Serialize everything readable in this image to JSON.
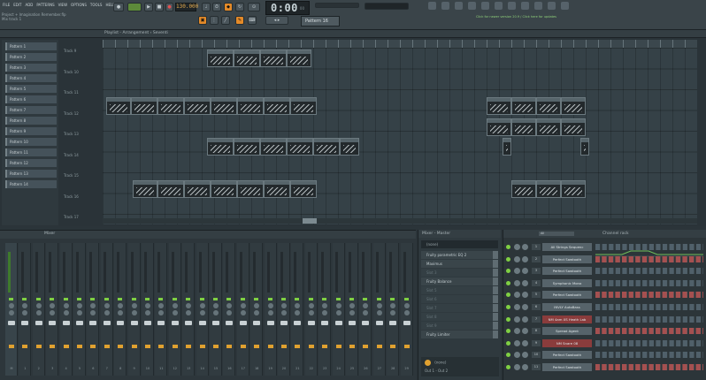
{
  "menu": [
    "FILE",
    "EDIT",
    "ADD",
    "PATTERNS",
    "VIEW",
    "OPTIONS",
    "TOOLS",
    "HELP"
  ],
  "project": {
    "name": "Project + Imagination Remember.flp",
    "subtitle": "Mix track 1"
  },
  "transport": {
    "tempo": "130.000",
    "time": "0:00",
    "time_sub": "00",
    "pattern": "Pattern 16"
  },
  "hint": "Click for newer version 20.9 / Click here for updates",
  "playlist": {
    "title": "Playlist - Arrangement › Seventi",
    "patterns": [
      "Pattern 1",
      "Pattern 2",
      "Pattern 3",
      "Pattern 4",
      "Pattern 5",
      "Pattern 6",
      "Pattern 7",
      "Pattern 8",
      "Pattern 9",
      "Pattern 10",
      "Pattern 11",
      "Pattern 12",
      "Pattern 13",
      "Pattern 14"
    ],
    "tracks": [
      "Track 9",
      "Track 10",
      "Track 11",
      "Track 12",
      "Track 13",
      "Track 14",
      "Track 15",
      "Track 16",
      "Track 17"
    ]
  },
  "mixer": {
    "title": "Mixer",
    "strips": [
      "M",
      "1",
      "2",
      "3",
      "4",
      "5",
      "6",
      "7",
      "8",
      "9",
      "10",
      "11",
      "12",
      "13",
      "14",
      "15",
      "16",
      "17",
      "18",
      "19",
      "20",
      "21",
      "22",
      "23",
      "24",
      "25",
      "26",
      "27",
      "28",
      "29"
    ]
  },
  "inserts": {
    "title": "Mixer - Master",
    "input": "(none)",
    "slots": [
      {
        "name": "Fruity parametric EQ 2",
        "empty": false
      },
      {
        "name": "Maximus",
        "empty": false
      },
      {
        "name": "Slot 3",
        "empty": true
      },
      {
        "name": "Fruity Balance",
        "empty": false
      },
      {
        "name": "Slot 5",
        "empty": true
      },
      {
        "name": "Slot 6",
        "empty": true
      },
      {
        "name": "Slot 7",
        "empty": true
      },
      {
        "name": "Slot 8",
        "empty": true
      },
      {
        "name": "Slot 9",
        "empty": true
      },
      {
        "name": "Fruity Limiter",
        "empty": false
      }
    ],
    "output": "(none)",
    "output_sub": "Out 1 - Out 2"
  },
  "rack": {
    "title": "Channel rack",
    "filter": "All",
    "channels": [
      {
        "num": "1",
        "name": "All Strings Sequenc",
        "red": false
      },
      {
        "num": "2",
        "name": "Perfect Sawtooth",
        "red": false
      },
      {
        "num": "3",
        "name": "Perfect Sawtooth",
        "red": false
      },
      {
        "num": "4",
        "name": "Symphonic Mono",
        "red": false
      },
      {
        "num": "5",
        "name": "Perfect Sawtooth",
        "red": false
      },
      {
        "num": "6",
        "name": "INVLY AutoBass",
        "red": false
      },
      {
        "num": "7",
        "name": "NM 4am XS Heath Lab",
        "red": true
      },
      {
        "num": "8",
        "name": "Spread Agent",
        "red": false
      },
      {
        "num": "9",
        "name": "NM Snare 08",
        "red": true
      },
      {
        "num": "10",
        "name": "Perfect Sawtooth",
        "red": false
      },
      {
        "num": "11",
        "name": "Perfect Sawtooth",
        "red": false
      }
    ]
  },
  "colors": {
    "accent": "#e48a28",
    "led": "#7fd043",
    "send": "#e0a130"
  }
}
